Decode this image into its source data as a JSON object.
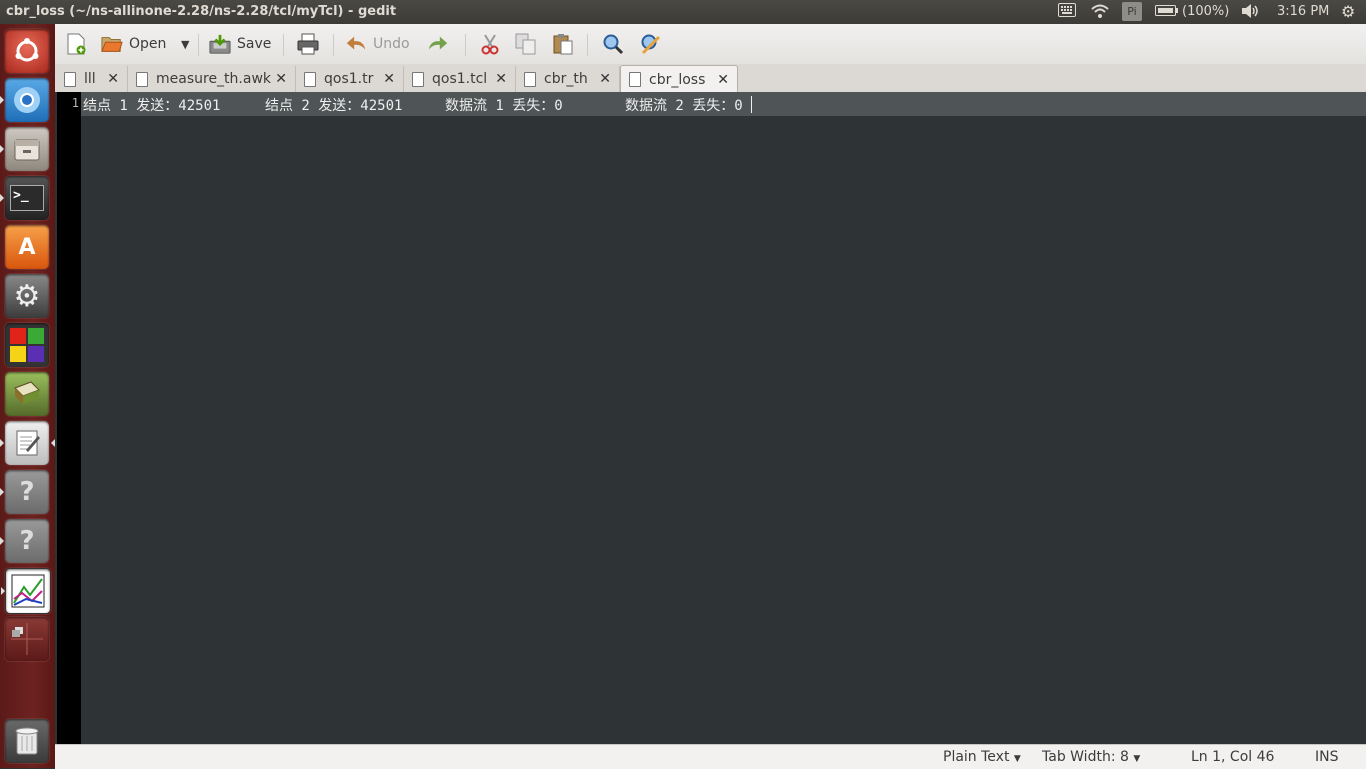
{
  "window": {
    "title": "cbr_loss (~/ns-allinone-2.28/ns-2.28/tcl/myTcl) - gedit"
  },
  "panel": {
    "battery": "(100%)",
    "time": "3:16 PM",
    "indicator_letter": "Pi"
  },
  "toolbar": {
    "open_label": "Open",
    "save_label": "Save",
    "undo_label": "Undo"
  },
  "tabs": [
    {
      "label": "lll"
    },
    {
      "label": "measure_th.awk"
    },
    {
      "label": "qos1.tr"
    },
    {
      "label": "qos1.tcl"
    },
    {
      "label": "cbr_th"
    },
    {
      "label": "cbr_loss"
    }
  ],
  "editor": {
    "line_number": "1",
    "segments": [
      "结点 1 发送：42501",
      "结点 2 发送：42501",
      "数据流 1 丢失：0",
      "数据流 2 丢失：0"
    ]
  },
  "statusbar": {
    "language": "Plain Text",
    "tab_width": "Tab Width: 8",
    "position": "Ln 1, Col 46",
    "mode": "INS"
  },
  "colors": {
    "launcher": "#6d2320",
    "editor_bg": "#2e3436",
    "current_line": "#4f5457",
    "panel": "#3c3b37"
  }
}
